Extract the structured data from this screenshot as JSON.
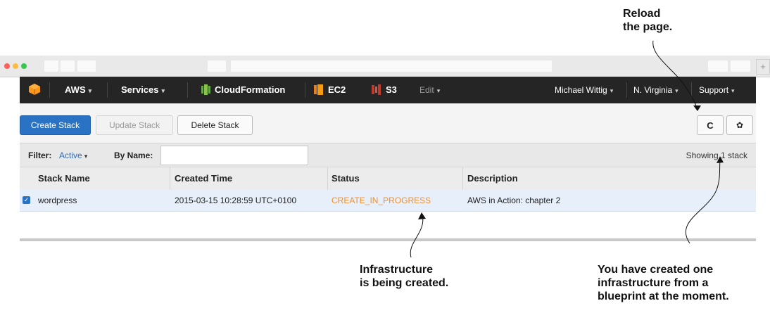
{
  "nav": {
    "aws_label": "AWS",
    "services_label": "Services",
    "cloudformation_label": "CloudFormation",
    "ec2_label": "EC2",
    "s3_label": "S3",
    "edit_label": "Edit",
    "user_label": "Michael Wittig",
    "region_label": "N. Virginia",
    "support_label": "Support",
    "caret": "▾"
  },
  "toolbar": {
    "create_label": "Create Stack",
    "update_label": "Update Stack",
    "delete_label": "Delete Stack",
    "refresh_icon": "C",
    "settings_icon": "✿"
  },
  "filter": {
    "filter_label": "Filter:",
    "active_label": "Active",
    "by_name_label": "By Name:",
    "name_value": "",
    "showing_prefix": "Showing ",
    "showing_count": "1",
    "showing_suffix": " stack"
  },
  "table": {
    "columns": [
      "Stack Name",
      "Created Time",
      "Status",
      "Description"
    ],
    "rows": [
      {
        "checked": true,
        "name": "wordpress",
        "created": "2015-03-15 10:28:59 UTC+0100",
        "status": "CREATE_IN_PROGRESS",
        "description": "AWS in Action: chapter 2"
      }
    ]
  },
  "colors": {
    "status_in_progress": "#f0902c",
    "primary_button": "#2a73c4",
    "nav_bg": "#252525",
    "link_blue": "#2a6ebb"
  },
  "annotations": {
    "reload": "Reload\nthe page.",
    "infrastructure": "Infrastructure\nis being created.",
    "created_one": "You have created one\ninfrastructure from a\nblueprint at the moment."
  }
}
